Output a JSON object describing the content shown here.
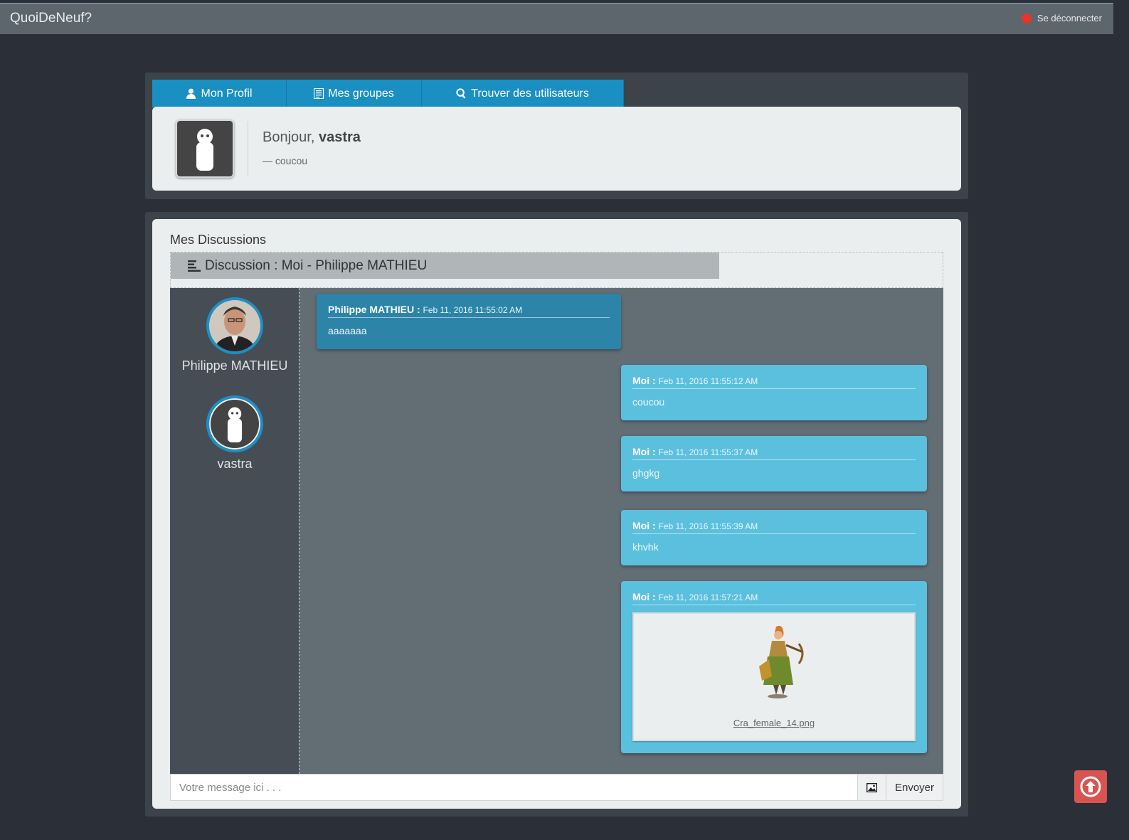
{
  "header": {
    "brand": "QuoiDeNeuf?",
    "logout_label": "Se déconnecter"
  },
  "tabs": [
    {
      "label": "Mon Profil",
      "icon": "user-icon"
    },
    {
      "label": "Mes groupes",
      "icon": "list-icon"
    },
    {
      "label": "Trouver des utilisateurs",
      "icon": "search-icon"
    }
  ],
  "profile": {
    "greeting_prefix": "Bonjour, ",
    "username": "vastra",
    "status": "— coucou"
  },
  "discussions": {
    "section_title": "Mes Discussions",
    "discussion_title": "Discussion : Moi - Philippe MATHIEU",
    "members": [
      {
        "name": "Philippe MATHIEU",
        "avatar": "photo"
      },
      {
        "name": "vastra",
        "avatar": "default-silhouette"
      }
    ],
    "messages": [
      {
        "author": "Philippe MATHIEU :",
        "time": "Feb 11, 2016 11:55:02 AM",
        "text": "aaaaaaa",
        "mine": false
      },
      {
        "author": "Moi :",
        "time": "Feb 11, 2016 11:55:12 AM",
        "text": "coucou",
        "mine": true
      },
      {
        "author": "Moi :",
        "time": "Feb 11, 2016 11:55:37 AM",
        "text": "ghgkg",
        "mine": true
      },
      {
        "author": "Moi :",
        "time": "Feb 11, 2016 11:55:39 AM",
        "text": "khvhk",
        "mine": true
      },
      {
        "author": "Moi :",
        "time": "Feb 11, 2016 11:57:21 AM",
        "attachment": "Cra_female_14.png",
        "mine": true
      }
    ],
    "input_placeholder": "Votre message ici . . .",
    "send_label": "Envoyer"
  },
  "colors": {
    "topbar": "#5d666d",
    "tab": "#1a8fc2",
    "message_other": "#2c84a8",
    "message_mine": "#5bc0de",
    "logout_dot": "#e8342a",
    "scroll_top": "#d9534f"
  }
}
